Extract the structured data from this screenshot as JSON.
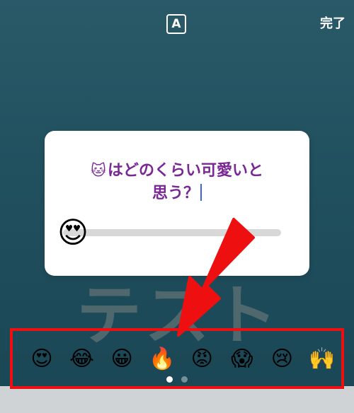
{
  "header": {
    "text_style_label": "A",
    "done_label": "完了"
  },
  "background_text": "テスト",
  "question_card": {
    "emoji": "🐱",
    "question_line1": "はどのくらい可愛いと",
    "question_line2": "思う？",
    "slider_emoji": "😍"
  },
  "emoji_tray": {
    "emojis": [
      "😍",
      "😂",
      "😀",
      "🔥",
      "😡",
      "😱",
      "😢",
      "🙌"
    ],
    "page_count": 2,
    "active_page": 1
  },
  "annotation": {
    "color": "#ee1010"
  },
  "colors": {
    "question_text": "#7a2796",
    "background": "#21505f",
    "caret": "#3a64e0"
  }
}
